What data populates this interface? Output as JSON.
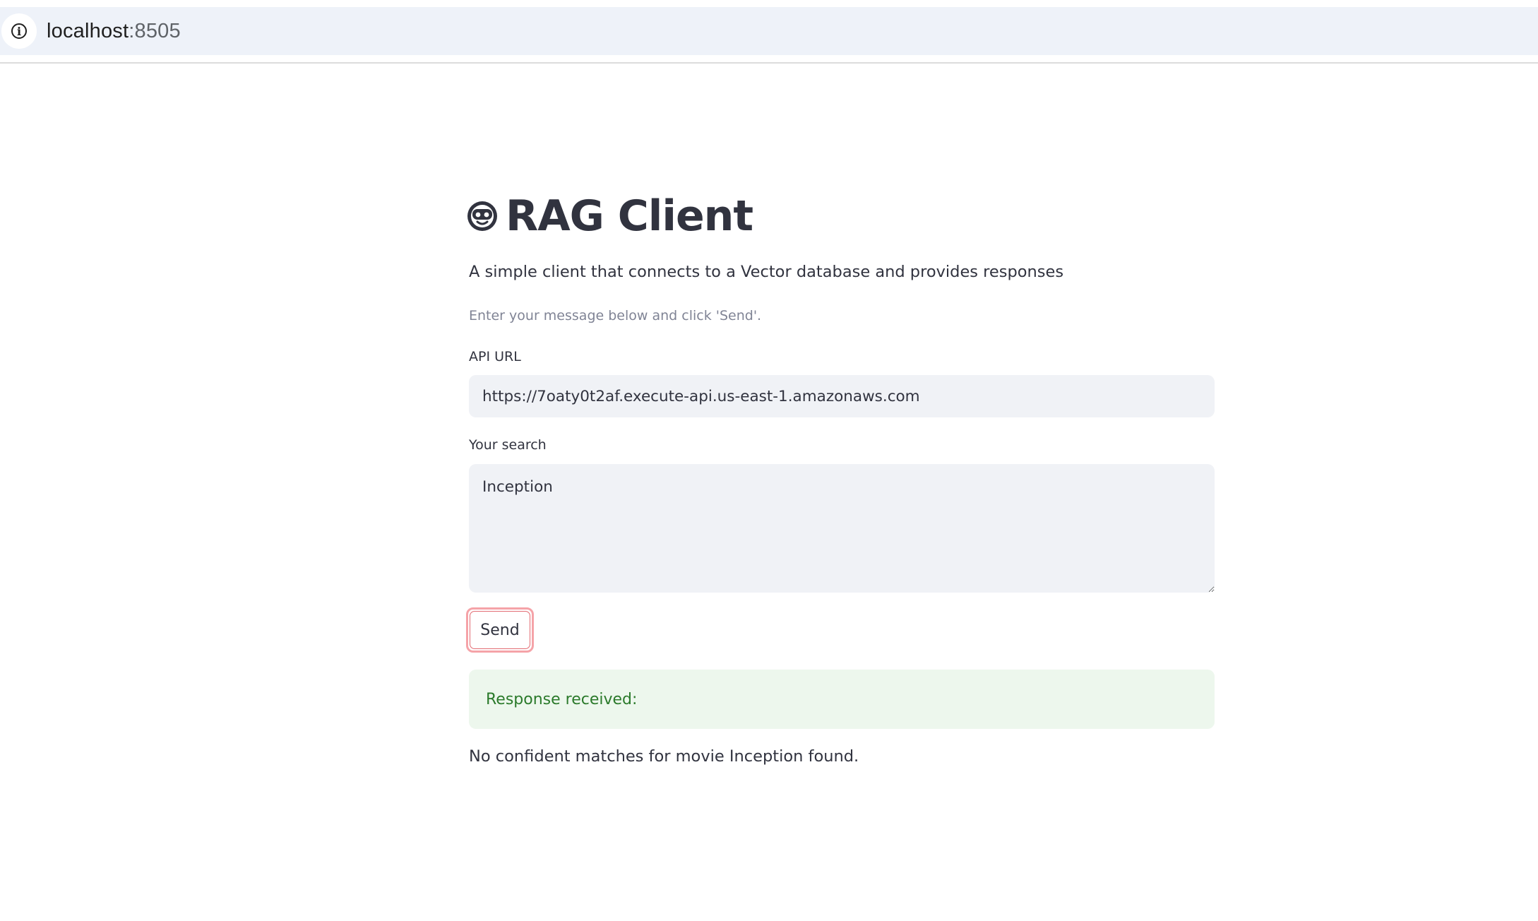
{
  "browser": {
    "url_host": "localhost",
    "url_port": ":8505"
  },
  "app": {
    "title": "RAG Client",
    "title_icon": "robot-face-icon",
    "subtitle": "A simple client that connects to a Vector database and provides responses",
    "caption": "Enter your message below and click 'Send'."
  },
  "form": {
    "api_url_label": "API URL",
    "api_url_value": "https://7oaty0t2af.execute-api.us-east-1.amazonaws.com",
    "search_label": "Your search",
    "search_value": "Inception",
    "send_label": "Send"
  },
  "result": {
    "status": "Response received:",
    "message": "No confident matches for movie Inception found."
  },
  "colors": {
    "accent": "#ff4b4b",
    "success_bg": "#edf7ed",
    "success_text": "#2b7a2b",
    "input_bg": "#f0f2f6"
  }
}
